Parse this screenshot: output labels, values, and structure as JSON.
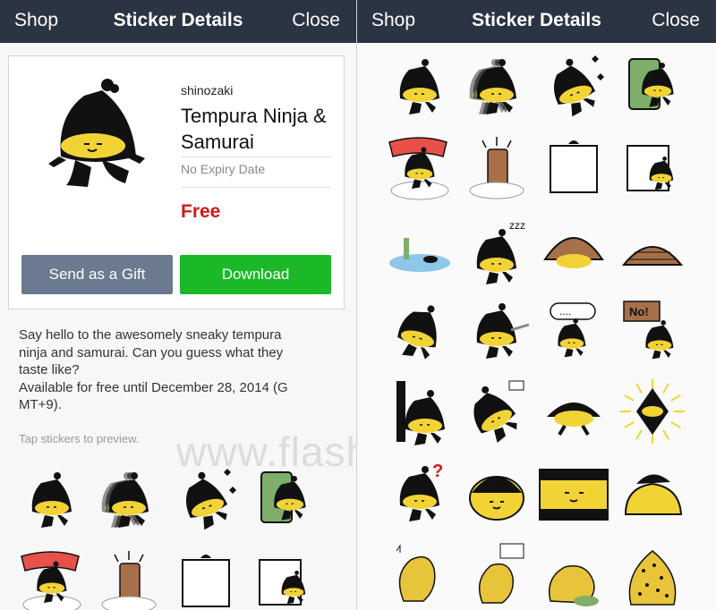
{
  "nav": {
    "left": "Shop",
    "title": "Sticker Details",
    "right": "Close"
  },
  "package": {
    "author": "shinozaki",
    "title": "Tempura Ninja & Samurai",
    "expiry": "No Expiry Date",
    "price": "Free",
    "gift_label": "Send as a Gift",
    "download_label": "Download"
  },
  "description": "Say hello to the awesomely sneaky tempura\nninja and samurai. Can you guess what they\ntaste like?\nAvailable for free until December 28, 2014 (G\nMT+9).",
  "preview_hint": "Tap stickers to preview.",
  "watermark": "www.flashfly.net",
  "colors": {
    "navbar": "#2b3442",
    "download": "#1bb927",
    "gift": "#6b7a8f",
    "price": "#d0171b",
    "sticker_yellow": "#f2d335"
  },
  "stickers": [
    {
      "name": "ninja-standing"
    },
    {
      "name": "ninja-dashing-blur"
    },
    {
      "name": "ninja-throwing-stars"
    },
    {
      "name": "ninja-bamboo-scroll"
    },
    {
      "name": "ninja-boom"
    },
    {
      "name": "ninja-log-trick"
    },
    {
      "name": "ninja-holding-blank-sign"
    },
    {
      "name": "ninja-peeking-paper"
    },
    {
      "name": "ninja-in-water"
    },
    {
      "name": "ninja-sleeping-zzz"
    },
    {
      "name": "ninja-under-hat"
    },
    {
      "name": "hat-only"
    },
    {
      "name": "ninja-leaping"
    },
    {
      "name": "ninja-sword-run"
    },
    {
      "name": "ninja-speech-bubble"
    },
    {
      "name": "ninja-no-sign"
    },
    {
      "name": "ninja-wall-hide"
    },
    {
      "name": "ninja-pointing-up"
    },
    {
      "name": "ninja-bowing"
    },
    {
      "name": "ninja-glowing"
    },
    {
      "name": "ninja-question"
    },
    {
      "name": "samurai-face-closeup"
    },
    {
      "name": "samurai-yellow-frame"
    },
    {
      "name": "samurai-lying"
    },
    {
      "name": "shrimp-music"
    },
    {
      "name": "shrimp-cheer"
    },
    {
      "name": "shrimp-sitting"
    },
    {
      "name": "shrimp-dotted"
    }
  ]
}
